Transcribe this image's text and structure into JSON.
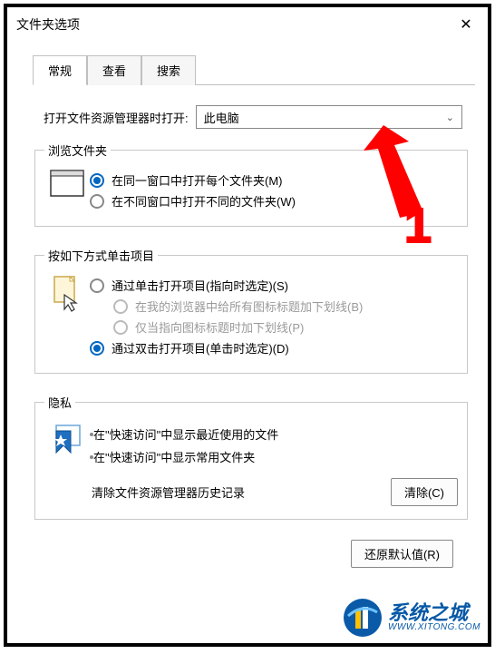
{
  "dialog": {
    "title": "文件夹选项",
    "close_glyph": "✕"
  },
  "tabs": {
    "general": "常规",
    "view": "查看",
    "search": "搜索"
  },
  "open_explorer": {
    "label": "打开文件资源管理器时打开:",
    "value": "此电脑"
  },
  "browse": {
    "legend": "浏览文件夹",
    "same_window": "在同一窗口中打开每个文件夹(M)",
    "new_window": "在不同窗口中打开不同的文件夹(W)"
  },
  "click": {
    "legend": "按如下方式单击项目",
    "single": "通过单击打开项目(指向时选定)(S)",
    "underline_all": "在我的浏览器中给所有图标标题加下划线(B)",
    "underline_point": "仅当指向图标标题时加下划线(P)",
    "double": "通过双击打开项目(单击时选定)(D)"
  },
  "privacy": {
    "legend": "隐私",
    "recent": "在\"快速访问\"中显示最近使用的文件",
    "frequent": "在\"快速访问\"中显示常用文件夹",
    "clear_label": "清除文件资源管理器历史记录",
    "clear_btn": "清除(C)"
  },
  "restore_btn": "还原默认值(R)",
  "annotation": {
    "number": "1"
  },
  "watermark": {
    "cn": "系统之城",
    "url": "WWW.XITONG.COM"
  }
}
